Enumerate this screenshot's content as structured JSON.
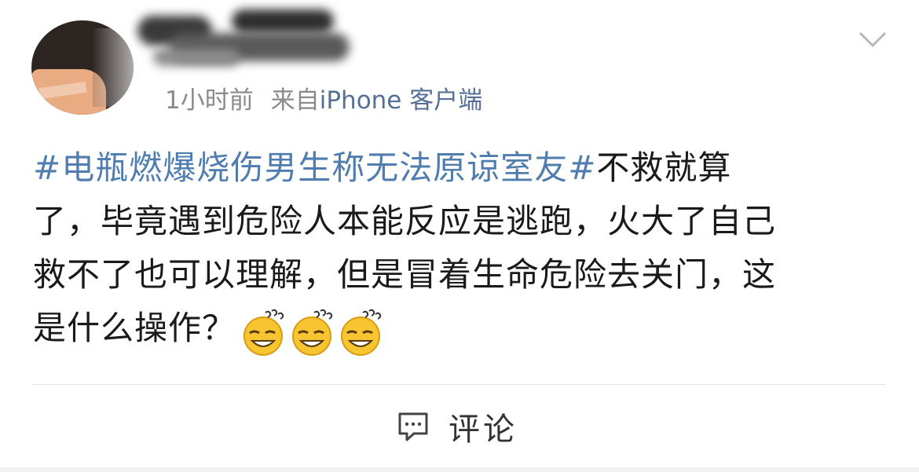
{
  "post": {
    "meta": {
      "time": "1小时前",
      "source_prefix": "来自",
      "source": "iPhone 客户端"
    },
    "icons": {
      "avatar": "avatar",
      "more": "chevron-down-icon",
      "emoji": "doge-emoji-icon",
      "comment": "comment-bubble-icon"
    },
    "content": {
      "topic": "#电瓶燃爆烧伤男生称无法原谅室友#",
      "line1_rest": "不救就算",
      "line2": "了，毕竟遇到危险人本能反应是逃跑，火大了自己",
      "line3": "救不了也可以理解，但是冒着生命危险去关门，这",
      "line4": "是什么操作？"
    },
    "actions": {
      "comment_label": "评论"
    },
    "colors": {
      "topic": "#507daf",
      "source": "#556f95",
      "meta": "#8a8a8a",
      "text": "#1a1a1a"
    }
  }
}
